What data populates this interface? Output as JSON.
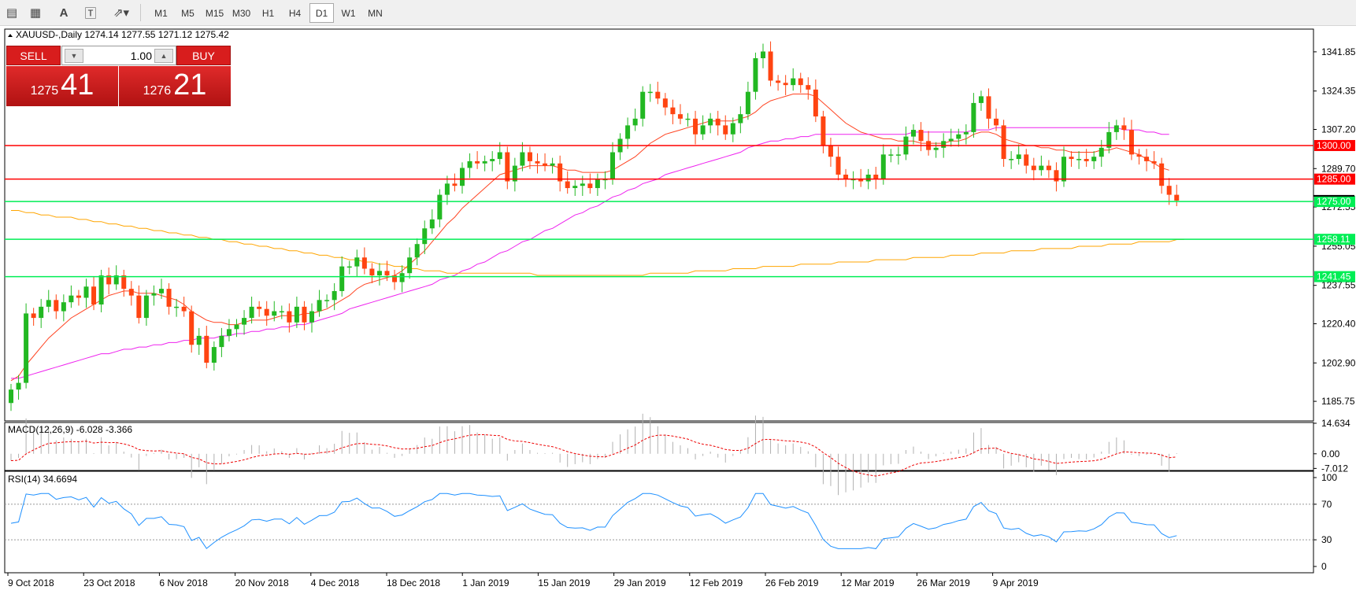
{
  "toolbar": {
    "icons": [
      "line-studies-icon",
      "grid-icon",
      "text-icon",
      "text-label-icon",
      "arrows-icon"
    ],
    "timeframes": [
      "M1",
      "M5",
      "M15",
      "M30",
      "H1",
      "H4",
      "D1",
      "W1",
      "MN"
    ],
    "active_timeframe": "D1"
  },
  "trade_panel": {
    "sell_label": "SELL",
    "buy_label": "BUY",
    "lot": "1.00",
    "sell_price_prefix": "1275",
    "sell_price_big": "41",
    "buy_price_prefix": "1276",
    "buy_price_big": "21"
  },
  "colors": {
    "bull": "#22b822",
    "bear": "#ff4411",
    "ma_fast": "#ff4422",
    "ma_mid": "#ee22ee",
    "ma_slow": "#ffa500",
    "level_red": "#ff0000",
    "level_green": "#00ee55",
    "rsi": "#1e90ff",
    "macd_signal": "#ee0000"
  },
  "chart_data": [
    {
      "type": "candlestick",
      "title": "XAUUSD-,Daily  1274.14 1277.55 1271.12 1275.42",
      "ylim": [
        1177,
        1352
      ],
      "y_ticks": [
        "1341.85",
        "1324.35",
        "1307.20",
        "1289.70",
        "1272.55",
        "1255.05",
        "1237.55",
        "1220.40",
        "1202.90",
        "1185.75"
      ],
      "x_ticks": [
        "9 Oct 2018",
        "23 Oct 2018",
        "6 Nov 2018",
        "20 Nov 2018",
        "4 Dec 2018",
        "18 Dec 2018",
        "1 Jan 2019",
        "15 Jan 2019",
        "29 Jan 2019",
        "12 Feb 2019",
        "26 Feb 2019",
        "12 Mar 2019",
        "26 Mar 2019",
        "9 Apr 2019"
      ],
      "levels": [
        {
          "label": "1300.00",
          "value": 1300.0,
          "color": "red"
        },
        {
          "label": "1285.00",
          "value": 1285.0,
          "color": "red"
        },
        {
          "label": "1275.00",
          "value": 1275.0,
          "color": "green"
        },
        {
          "label": "1258.11",
          "value": 1258.11,
          "color": "green"
        },
        {
          "label": "1241.45",
          "value": 1241.45,
          "color": "green"
        }
      ],
      "closes": [
        1191,
        1194,
        1225,
        1223,
        1228,
        1231,
        1226,
        1230,
        1233,
        1232,
        1237,
        1229,
        1242,
        1238,
        1242,
        1236,
        1233,
        1223,
        1233,
        1234,
        1236,
        1228,
        1228,
        1226,
        1211,
        1215,
        1203,
        1210,
        1215,
        1218,
        1220,
        1223,
        1228,
        1227,
        1224,
        1226,
        1226,
        1221,
        1228,
        1221,
        1226,
        1231,
        1231,
        1235,
        1246,
        1246,
        1250,
        1245,
        1242,
        1244,
        1242,
        1239,
        1243,
        1250,
        1256,
        1263,
        1267,
        1278,
        1283,
        1282,
        1290,
        1293,
        1292,
        1293,
        1294,
        1297,
        1284,
        1291,
        1297,
        1293,
        1292,
        1291,
        1292,
        1284,
        1281,
        1282,
        1283,
        1281,
        1285,
        1285,
        1297,
        1303,
        1309,
        1312,
        1324,
        1324,
        1321,
        1317,
        1314,
        1312,
        1312,
        1305,
        1309,
        1312,
        1309,
        1305,
        1310,
        1314,
        1324,
        1339,
        1342,
        1329,
        1328,
        1327,
        1330,
        1327,
        1325,
        1313,
        1300,
        1295,
        1287,
        1285,
        1285,
        1284,
        1287,
        1285,
        1296,
        1296,
        1296,
        1304,
        1307,
        1302,
        1298,
        1299,
        1302,
        1303,
        1305,
        1306,
        1319,
        1322,
        1312,
        1309,
        1294,
        1294,
        1296,
        1291,
        1289,
        1291,
        1289,
        1284,
        1295,
        1294,
        1294,
        1293,
        1295,
        1299,
        1306,
        1309,
        1307,
        1296,
        1295,
        1293,
        1292,
        1282,
        1278,
        1275.42
      ],
      "series": [
        {
          "name": "MA-fast",
          "values": [
            1195,
            1197,
            1202,
            1206,
            1210,
            1214,
            1217,
            1220,
            1223,
            1225,
            1227,
            1229,
            1231,
            1233,
            1234,
            1235,
            1235,
            1234,
            1234,
            1234,
            1233,
            1232,
            1231,
            1229,
            1226,
            1224,
            1222,
            1221,
            1221,
            1220,
            1220,
            1221,
            1222,
            1222,
            1222,
            1223,
            1224,
            1224,
            1224,
            1225,
            1225,
            1226,
            1227,
            1229,
            1231,
            1233,
            1236,
            1238,
            1239,
            1240,
            1241,
            1242,
            1244,
            1247,
            1250,
            1253,
            1257,
            1261,
            1265,
            1268,
            1272,
            1275,
            1278,
            1281,
            1284,
            1287,
            1288,
            1289,
            1290,
            1291,
            1291,
            1291,
            1291,
            1290,
            1289,
            1289,
            1288,
            1288,
            1288,
            1288,
            1289,
            1291,
            1293,
            1295,
            1298,
            1301,
            1303,
            1305,
            1306,
            1307,
            1308,
            1309,
            1310,
            1311,
            1311,
            1311,
            1311,
            1312,
            1313,
            1315,
            1318,
            1320,
            1321,
            1322,
            1323,
            1323,
            1323,
            1322,
            1319,
            1316,
            1313,
            1310,
            1308,
            1306,
            1305,
            1304,
            1303,
            1303,
            1302,
            1302,
            1302,
            1301,
            1301,
            1301,
            1301,
            1302,
            1302,
            1303,
            1305,
            1306,
            1306,
            1305,
            1303,
            1302,
            1301,
            1300,
            1300,
            1299,
            1299,
            1298,
            1298,
            1297,
            1297,
            1297,
            1297,
            1298,
            1298,
            1299,
            1298,
            1297,
            1296,
            1294,
            1292,
            1290,
            1289
          ]
        },
        {
          "name": "MA-mid",
          "values": [
            1196,
            1196,
            1197,
            1198,
            1199,
            1200,
            1201,
            1202,
            1203,
            1204,
            1205,
            1206,
            1207,
            1207,
            1208,
            1209,
            1209,
            1210,
            1210,
            1211,
            1211,
            1212,
            1212,
            1213,
            1213,
            1214,
            1214,
            1214,
            1215,
            1215,
            1216,
            1216,
            1217,
            1217,
            1218,
            1218,
            1219,
            1219,
            1220,
            1220,
            1221,
            1222,
            1223,
            1224,
            1225,
            1227,
            1228,
            1229,
            1230,
            1231,
            1232,
            1233,
            1234,
            1235,
            1236,
            1237,
            1238,
            1240,
            1241,
            1242,
            1244,
            1245,
            1247,
            1248,
            1250,
            1252,
            1253,
            1255,
            1257,
            1258,
            1260,
            1262,
            1263,
            1265,
            1267,
            1269,
            1270,
            1272,
            1273,
            1275,
            1277,
            1278,
            1280,
            1281,
            1283,
            1284,
            1285,
            1287,
            1288,
            1289,
            1290,
            1291,
            1292,
            1293,
            1294,
            1295,
            1296,
            1297,
            1299,
            1300,
            1301,
            1302,
            1302,
            1303,
            1303,
            1304,
            1304,
            1305,
            1305,
            1305,
            1305,
            1305,
            1305,
            1305,
            1305,
            1305,
            1305,
            1305,
            1305,
            1305,
            1306,
            1306,
            1306,
            1306,
            1306,
            1306,
            1306,
            1306,
            1307,
            1307,
            1307,
            1308,
            1308,
            1308,
            1308,
            1308,
            1308,
            1308,
            1308,
            1308,
            1308,
            1308,
            1308,
            1308,
            1308,
            1308,
            1308,
            1308,
            1307,
            1307,
            1307,
            1306,
            1306,
            1305,
            1305
          ]
        },
        {
          "name": "MA-slow",
          "values": [
            1271,
            1271,
            1270,
            1270,
            1269,
            1269,
            1268,
            1268,
            1268,
            1267,
            1267,
            1266,
            1266,
            1265,
            1265,
            1264,
            1264,
            1263,
            1263,
            1262,
            1262,
            1261,
            1261,
            1260,
            1260,
            1259,
            1259,
            1258,
            1258,
            1257,
            1257,
            1256,
            1256,
            1255,
            1255,
            1254,
            1254,
            1253,
            1253,
            1252,
            1252,
            1251,
            1251,
            1250,
            1250,
            1249,
            1249,
            1248,
            1248,
            1247,
            1247,
            1246,
            1246,
            1245,
            1245,
            1244,
            1244,
            1244,
            1243,
            1243,
            1243,
            1243,
            1243,
            1243,
            1243,
            1243,
            1243,
            1243,
            1243,
            1243,
            1242,
            1242,
            1242,
            1242,
            1242,
            1242,
            1242,
            1242,
            1242,
            1242,
            1242,
            1242,
            1242,
            1242,
            1242,
            1243,
            1243,
            1243,
            1243,
            1243,
            1243,
            1244,
            1244,
            1244,
            1244,
            1244,
            1245,
            1245,
            1245,
            1245,
            1246,
            1246,
            1246,
            1246,
            1246,
            1247,
            1247,
            1247,
            1247,
            1247,
            1248,
            1248,
            1248,
            1248,
            1248,
            1249,
            1249,
            1249,
            1249,
            1249,
            1250,
            1250,
            1250,
            1250,
            1250,
            1251,
            1251,
            1251,
            1251,
            1252,
            1252,
            1252,
            1252,
            1253,
            1253,
            1253,
            1253,
            1254,
            1254,
            1254,
            1254,
            1254,
            1255,
            1255,
            1255,
            1255,
            1256,
            1256,
            1256,
            1256,
            1257,
            1257,
            1257,
            1257,
            1257,
            1258,
            1258
          ]
        }
      ]
    },
    {
      "type": "bar",
      "title": "MACD(12,26,9) -6.028 -3.366",
      "y_ticks": [
        "14.634",
        "0.00",
        "-7.012"
      ],
      "ylim": [
        -8,
        15
      ]
    },
    {
      "type": "line",
      "title": "RSI(14) 34.6694",
      "y_ticks": [
        "100",
        "70",
        "30",
        "0"
      ],
      "ylim": [
        0,
        100
      ]
    }
  ]
}
